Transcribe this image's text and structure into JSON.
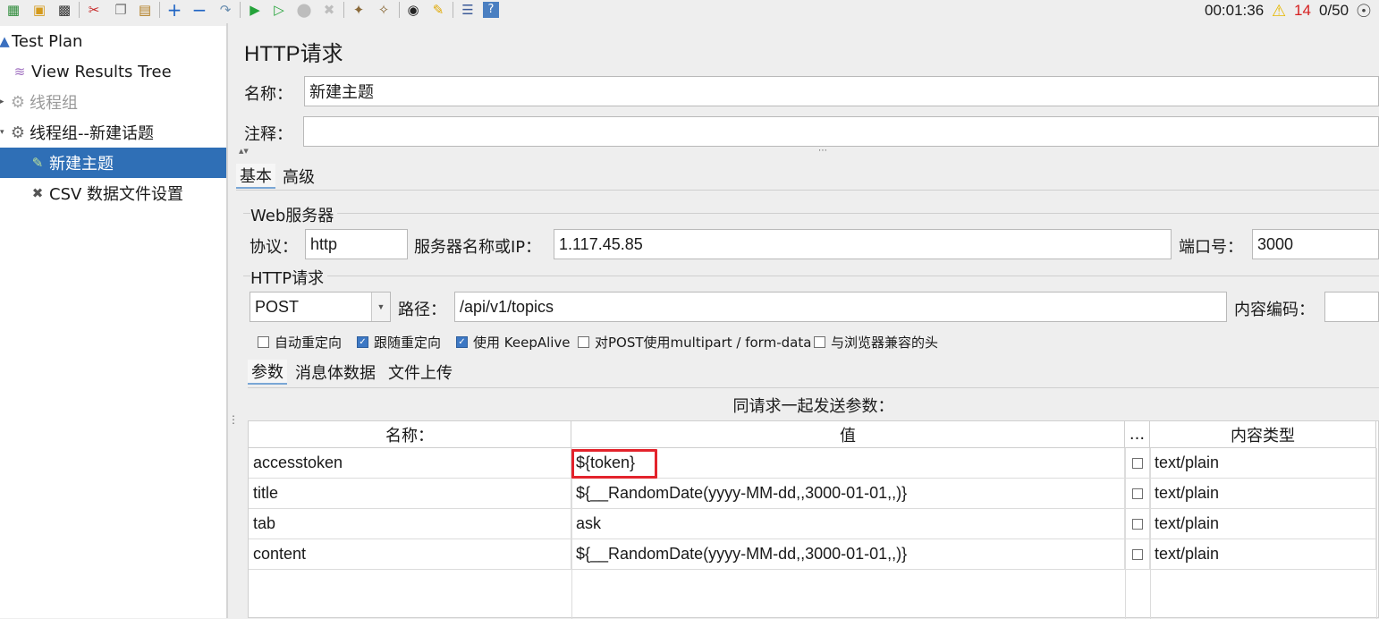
{
  "toolbar": {
    "icons": [
      "templates-icon",
      "open-icon",
      "save-icon",
      "cut-icon",
      "copy-icon",
      "paste-icon",
      "expand-icon",
      "collapse-icon",
      "toggle-icon",
      "start-icon",
      "start-no-pause-icon",
      "stop-icon",
      "shutdown-icon",
      "clear-icon",
      "clear-all-icon",
      "search-icon",
      "reset-search-icon",
      "function-helper-icon",
      "help-icon"
    ],
    "timer": "00:01:36",
    "warning_count": "14",
    "threads": "0/50"
  },
  "tree": {
    "items": [
      {
        "label": "Test Plan",
        "icon": "flask-icon"
      },
      {
        "label": "View Results Tree",
        "icon": "chart-icon"
      },
      {
        "label": "线程组",
        "icon": "gear-icon"
      },
      {
        "label": "线程组--新建话题",
        "icon": "gear-icon"
      },
      {
        "label": "新建主题",
        "icon": "pipette-icon"
      },
      {
        "label": "CSV 数据文件设置",
        "icon": "wrench-icon"
      }
    ]
  },
  "panel": {
    "title": "HTTP请求",
    "name_label": "名称：",
    "name_value": "新建主题",
    "comment_label": "注释：",
    "comment_value": ""
  },
  "tabs": {
    "basic": "基本",
    "advanced": "高级"
  },
  "web_server": {
    "title": "Web服务器",
    "protocol_label": "协议：",
    "protocol_value": "http",
    "server_label": "服务器名称或IP：",
    "server_value": "1.117.45.85",
    "port_label": "端口号：",
    "port_value": "3000"
  },
  "http_request": {
    "title": "HTTP请求",
    "method": "POST",
    "path_label": "路径：",
    "path_value": "/api/v1/topics",
    "encoding_label": "内容编码：",
    "encoding_value": ""
  },
  "options": [
    {
      "label": "自动重定向",
      "checked": false
    },
    {
      "label": "跟随重定向",
      "checked": true
    },
    {
      "label": "使用 KeepAlive",
      "checked": true
    },
    {
      "label": "对POST使用multipart / form-data",
      "checked": false
    },
    {
      "label": "与浏览器兼容的头",
      "checked": false
    }
  ],
  "sub_tabs": {
    "params": "参数",
    "body": "消息体数据",
    "files": "文件上传"
  },
  "params": {
    "caption": "同请求一起发送参数：",
    "headers": {
      "name": "名称：",
      "value": "值",
      "encode": "...",
      "content_type": "内容类型"
    },
    "rows": [
      {
        "name": "accesstoken",
        "value": "${token}",
        "content_type": "text/plain"
      },
      {
        "name": "title",
        "value": "${__RandomDate(yyyy-MM-dd,,3000-01-01,,)}",
        "content_type": "text/plain"
      },
      {
        "name": "tab",
        "value": "ask",
        "content_type": "text/plain"
      },
      {
        "name": "content",
        "value": "${__RandomDate(yyyy-MM-dd,,3000-01-01,,)}",
        "content_type": "text/plain"
      }
    ]
  }
}
